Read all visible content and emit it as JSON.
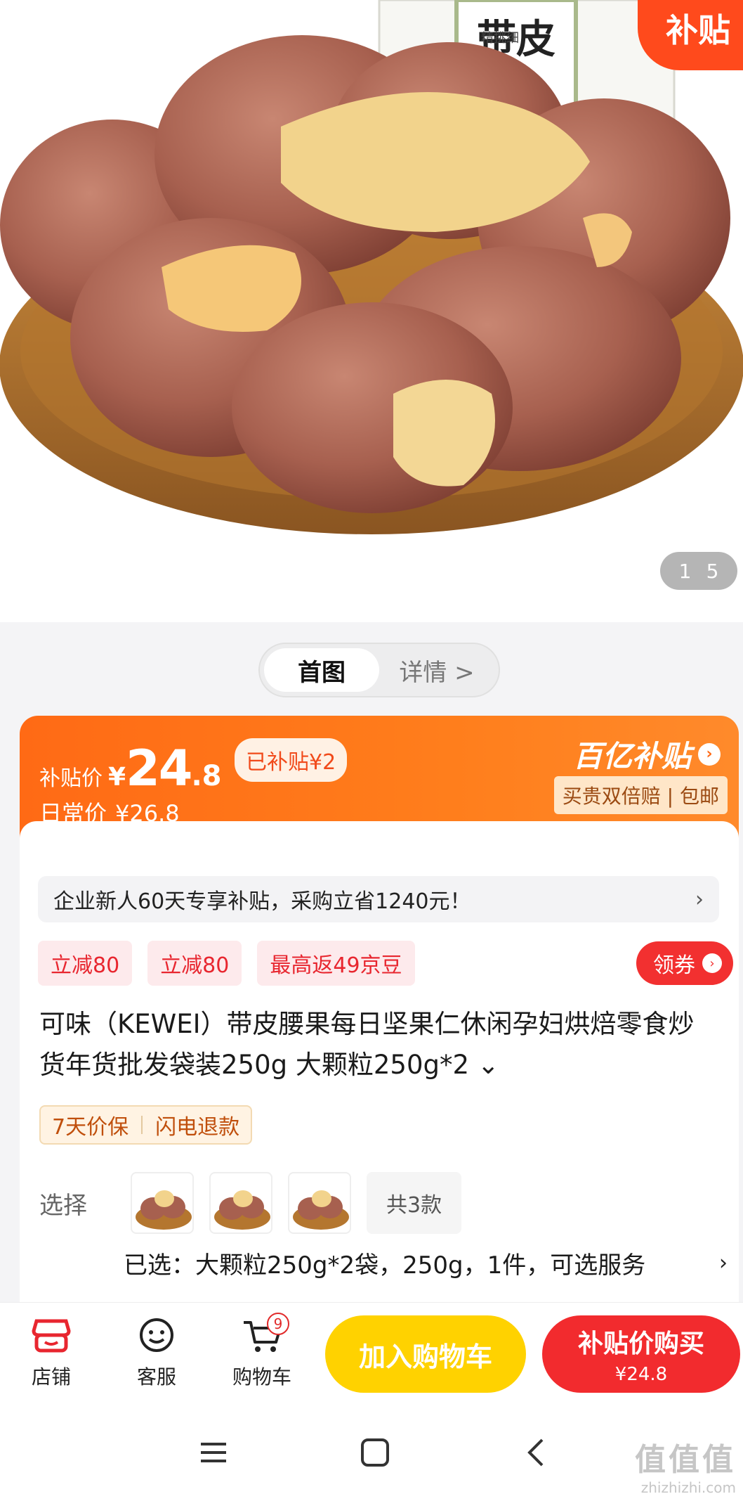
{
  "hero": {
    "badge_text": "补贴",
    "package_text": "带皮",
    "package_small": "精挑细",
    "image_counter": {
      "current": "1",
      "total": "5"
    }
  },
  "tabs": [
    {
      "label": "首图"
    },
    {
      "label": "详情 >"
    }
  ],
  "price": {
    "label": "补贴价",
    "currency": "¥",
    "integer": "24",
    "decimal": ".8",
    "subsidy_chip": "已补贴¥2",
    "daily_label": "日常价",
    "daily_value": "¥26.8",
    "brand": "百亿补贴",
    "brand_arrow": "›",
    "brand_sub": "买贵双倍赔 | 包邮"
  },
  "promo": {
    "text": "企业新人60天专享补贴，采购立省1240元！",
    "chevron": "›"
  },
  "coupons": [
    {
      "label": "立减80"
    },
    {
      "label": "立减80"
    },
    {
      "label": "最高返49京豆"
    }
  ],
  "get_coupon": {
    "label": "领券",
    "arrow": "›"
  },
  "title": "可味（KEWEI）带皮腰果每日坚果仁休闲孕妇烘焙零食炒货年货批发袋装250g 大颗粒250g*2",
  "title_expand": "⌄",
  "service_chips": [
    {
      "label": "7天价保"
    },
    {
      "label": "闪电退款"
    }
  ],
  "selection": {
    "label": "选择",
    "total": "共3款",
    "selected": "已选：大颗粒250g*2袋，250g，1件，可选服务",
    "chevron": "›"
  },
  "bottom_nav": {
    "store": "店铺",
    "service": "客服",
    "cart": "购物车",
    "cart_count": "9"
  },
  "actions": {
    "add_to_cart": "加入购物车",
    "buy_label": "补贴价购买",
    "buy_price": "¥24.8"
  },
  "watermark": {
    "big": "值值值",
    "small": "zhizhizhi.com"
  },
  "colors": {
    "accent_orange": "#ff6a15",
    "accent_red": "#f22b2e",
    "cart_yellow": "#ffd200"
  }
}
